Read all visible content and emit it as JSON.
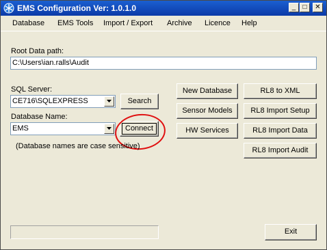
{
  "window": {
    "title": "EMS Configuration Ver: 1.0.1.0",
    "controls": {
      "minimize": "_",
      "maximize": "□",
      "close": "✕"
    }
  },
  "menu": [
    "Database",
    "EMS Tools",
    "Import / Export",
    "Archive",
    "Licence",
    "Help"
  ],
  "root_data": {
    "label": "Root Data path:",
    "value": "C:\\Users\\ian.ralls\\Audit"
  },
  "sql_server": {
    "label": "SQL Server:",
    "value": "CE716\\SQLEXPRESS",
    "search_label": "Search"
  },
  "database_name": {
    "label": "Database Name:",
    "value": "EMS",
    "connect_label": "Connect",
    "note": "(Database names are case sensitive)"
  },
  "buttons_left": [
    "New Database",
    "Sensor Models",
    "HW Services"
  ],
  "buttons_right": [
    "RL8 to XML",
    "RL8 Import Setup",
    "RL8 Import Data",
    "RL8 Import Audit"
  ],
  "exit_label": "Exit",
  "annotation_color": "#e01010"
}
